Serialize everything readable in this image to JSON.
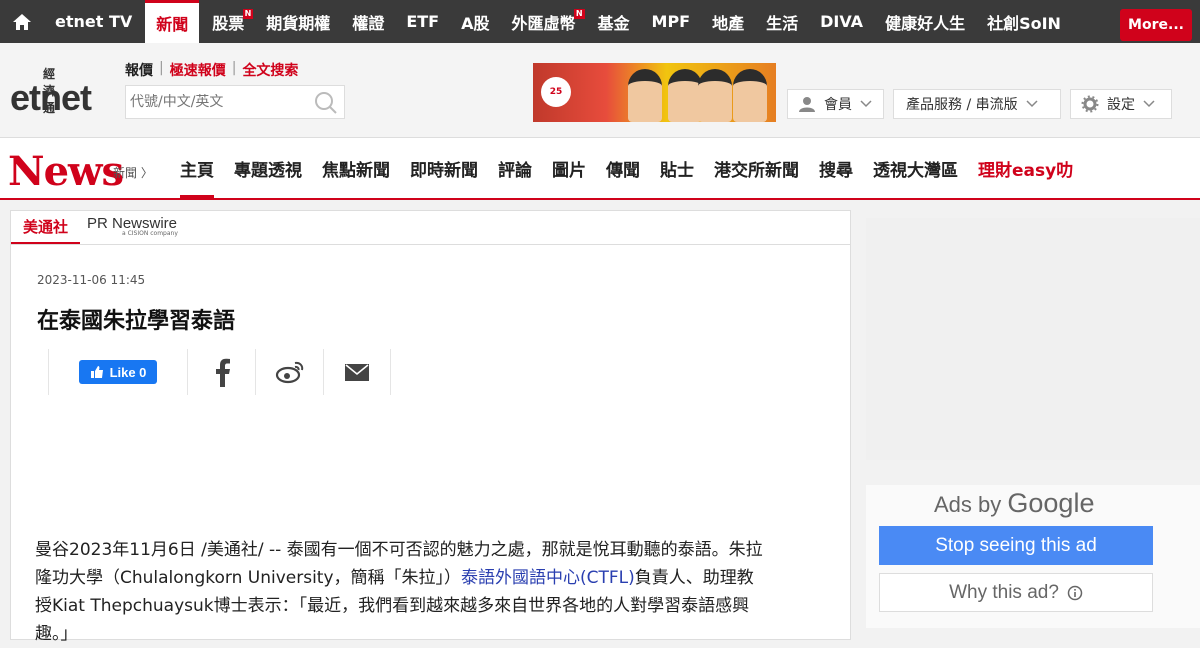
{
  "topnav": {
    "items": [
      {
        "label": "etnet TV",
        "active": false,
        "badge": ""
      },
      {
        "label": "新聞",
        "active": true,
        "badge": ""
      },
      {
        "label": "股票",
        "active": false,
        "badge": "N"
      },
      {
        "label": "期貨期權",
        "active": false,
        "badge": ""
      },
      {
        "label": "權證",
        "active": false,
        "badge": ""
      },
      {
        "label": "ETF",
        "active": false,
        "badge": ""
      },
      {
        "label": "A股",
        "active": false,
        "badge": ""
      },
      {
        "label": "外匯虛幣",
        "active": false,
        "badge": "N"
      },
      {
        "label": "基金",
        "active": false,
        "badge": ""
      },
      {
        "label": "MPF",
        "active": false,
        "badge": ""
      },
      {
        "label": "地產",
        "active": false,
        "badge": ""
      },
      {
        "label": "生活",
        "active": false,
        "badge": ""
      },
      {
        "label": "DIVA",
        "active": false,
        "badge": ""
      },
      {
        "label": "健康好人生",
        "active": false,
        "badge": ""
      },
      {
        "label": "社創SoIN",
        "active": false,
        "badge": ""
      }
    ],
    "more_label": "More..."
  },
  "header": {
    "logo_cn": "經濟通",
    "logo_en_a": "etnet",
    "quicklinks": [
      "報價",
      "極速報價",
      "全文搜索"
    ],
    "search_placeholder": "代號/中文/英文",
    "banner_badge": "25",
    "member_label": "會員",
    "products_label": "產品服務 / 串流版",
    "settings_label": "設定"
  },
  "newsnav": {
    "logo": "News",
    "logo_sub": "新聞",
    "tabs": [
      {
        "label": "主頁",
        "active": true,
        "red": false
      },
      {
        "label": "專題透視",
        "active": false,
        "red": false
      },
      {
        "label": "焦點新聞",
        "active": false,
        "red": false
      },
      {
        "label": "即時新聞",
        "active": false,
        "red": false
      },
      {
        "label": "評論",
        "active": false,
        "red": false
      },
      {
        "label": "圖片",
        "active": false,
        "red": false
      },
      {
        "label": "傳聞",
        "active": false,
        "red": false
      },
      {
        "label": "貼士",
        "active": false,
        "red": false
      },
      {
        "label": "港交所新聞",
        "active": false,
        "red": false
      },
      {
        "label": "搜尋",
        "active": false,
        "red": false
      },
      {
        "label": "透視大灣區",
        "active": false,
        "red": false
      },
      {
        "label": "理財easy叻",
        "active": false,
        "red": true
      }
    ]
  },
  "article": {
    "source_tab": "美通社",
    "source_logo": "PR Newswire",
    "source_logo_sub": "a CISION company",
    "date": "2023-11-06 11:45",
    "title": "在泰國朱拉學習泰語",
    "like_label": "Like 0",
    "body_line1": "曼谷2023年11月6日 /美通社/ -- 泰國有一個不可否認的魅力之處，那就是悅耳動聽的泰語。朱拉",
    "body_line2_a": "隆功大學（Chulalongkorn University，簡稱「朱拉」）",
    "body_line2_link": "泰語外國語中心(CTFL)",
    "body_line2_b": "負責人、助理教",
    "body_line3": "授Kiat Thepchuaysuk博士表示：「最近，我們看到越來越多來自世界各地的人對學習泰語感興",
    "body_line4": "趣。」"
  },
  "ads": {
    "ads_by": "Ads by",
    "google": "Google",
    "stop_label": "Stop seeing this ad",
    "why_label": "Why this ad?"
  },
  "colors": {
    "brand_red": "#d0021b",
    "topbar_bg": "#3a3a3a",
    "link_blue": "#2a3fb0",
    "google_blue": "#4a8af4",
    "fb_blue": "#1877f2"
  }
}
